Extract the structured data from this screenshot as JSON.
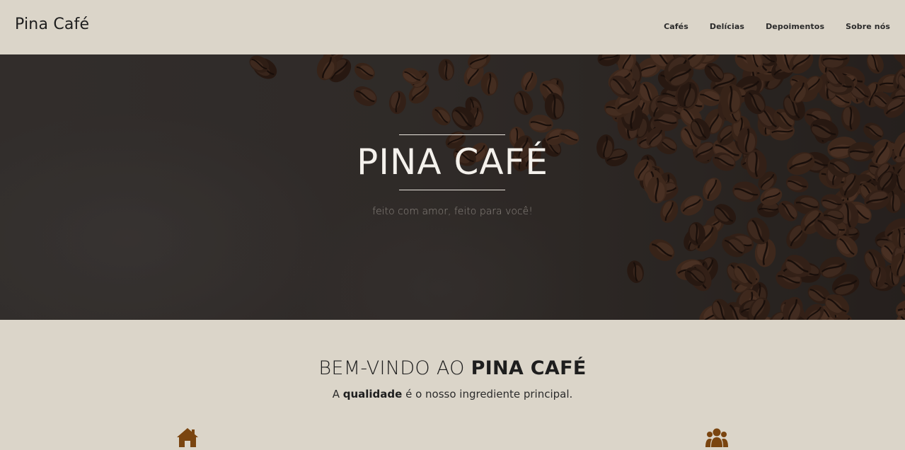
{
  "header": {
    "brand": "Pina Café",
    "nav": [
      {
        "label": "Cafés"
      },
      {
        "label": "Delícias"
      },
      {
        "label": "Depoimentos"
      },
      {
        "label": "Sobre nós"
      }
    ]
  },
  "hero": {
    "title": "PINA CAFÉ",
    "subtitle": "feito com amor, feito para você!"
  },
  "welcome": {
    "title_prefix": "BEM-VINDO AO ",
    "title_strong": "PINA CAFÉ",
    "sub_prefix": "A ",
    "sub_strong": "qualidade",
    "sub_suffix": " é o nosso ingrediente principal."
  },
  "features": [
    {
      "icon": "home-icon"
    },
    {
      "icon": "users-icon"
    }
  ],
  "colors": {
    "background": "#dbd5c9",
    "accent": "#7a4510",
    "hero_text": "#f4f1ec"
  }
}
